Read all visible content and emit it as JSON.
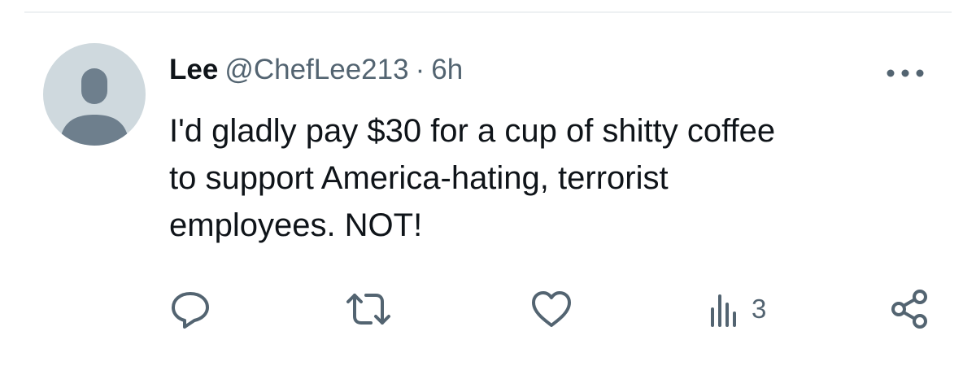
{
  "tweet": {
    "author_name": "Lee",
    "handle": "@ChefLee213",
    "separator": "·",
    "time": "6h",
    "text": "I'd gladly pay $30 for a cup of shitty coffee\nto support America-hating, terrorist\nemployees. NOT!",
    "avatar": "default-profile-icon",
    "more_icon": "more-options-icon"
  },
  "actions": {
    "reply_icon": "reply-icon",
    "retweet_icon": "retweet-icon",
    "like_icon": "heart-icon",
    "views_icon": "views-icon",
    "views_count": "3",
    "share_icon": "share-icon"
  },
  "colors": {
    "text_primary": "#0f1419",
    "text_secondary": "#536471",
    "avatar_bg": "#cfd9de",
    "avatar_fg": "#6e7f8d"
  }
}
